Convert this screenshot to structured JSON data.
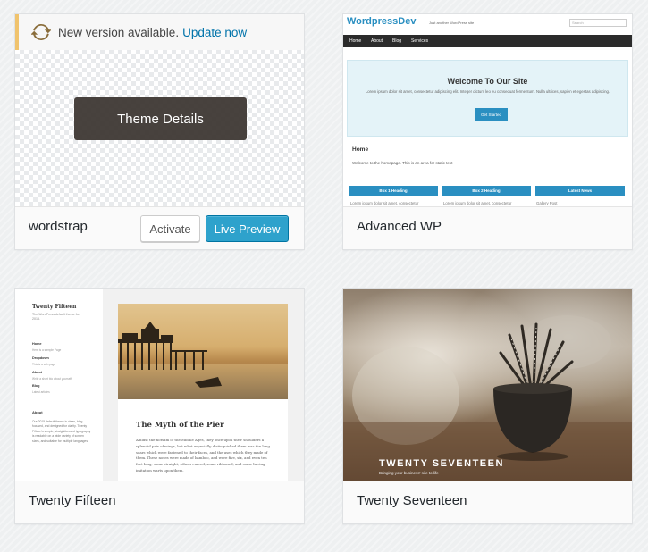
{
  "themes": [
    {
      "name": "wordstrap",
      "update_notice": {
        "text": "New version available.",
        "link": "Update now"
      },
      "overlay_button": "Theme Details",
      "actions": {
        "activate": "Activate",
        "preview": "Live Preview"
      }
    },
    {
      "name": "Advanced WP",
      "preview": {
        "brand": "WordpressDev",
        "tagline": "Just another WordPress site",
        "search": "Search",
        "nav": [
          "Home",
          "About",
          "Blog",
          "Services"
        ],
        "hero_title": "Welcome To Our Site",
        "hero_text": "Lorem ipsum dolor sit amet, consectetur adipiscing elit. Integer dictum leo eu consequat fermentum. Nulla ultrices, sapien et egestas adipiscing.",
        "hero_button": "Get Started",
        "home_heading": "Home",
        "home_text": "Welcome to the homepage. This is an area for static text",
        "boxes": [
          "Box 1 Heading",
          "Box 2 Heading",
          "Latest News"
        ],
        "box_texts": [
          "Lorem ipsum dolor sit amet, consectetur",
          "Lorem ipsum dolor sit amet, consectetur",
          "Gallery Post"
        ]
      }
    },
    {
      "name": "Twenty Fifteen",
      "preview": {
        "site_title": "Twenty Fifteen",
        "site_desc": "The WordPress default theme for 2015.",
        "menu": [
          {
            "label": "Home",
            "sub": "Here is a sample Page"
          },
          {
            "label": "Dropdown",
            "sub": "This is a sub-page"
          },
          {
            "label": "About",
            "sub": "Write a short bio about yourself"
          },
          {
            "label": "Blog",
            "sub": "Latest articles"
          }
        ],
        "about_heading": "About",
        "about_text": "Our 2015 default theme is clean, blog-focused, and designed for clarity. Twenty Fifteen's simple, straightforward typography is readable on a wide variety of screen sizes, and suitable for multiple languages.",
        "article_title": "The Myth of the Pier",
        "article_text": "Amidst the flotsam of the Middle Ages, they once upon their shoulders a splendid pair of wings, but what especially distinguished them was the long soars which were fastened to their faces, and the uses which they made of them. These noses were made of bamboo, and were five, six, and even ten feet long, some straight, others curved, some ribboned, and some having imitation warts upon them."
      }
    },
    {
      "name": "Twenty Seventeen",
      "preview": {
        "site_title": "TWENTY SEVENTEEN",
        "tagline": "Bringing your business' site to life"
      }
    }
  ]
}
